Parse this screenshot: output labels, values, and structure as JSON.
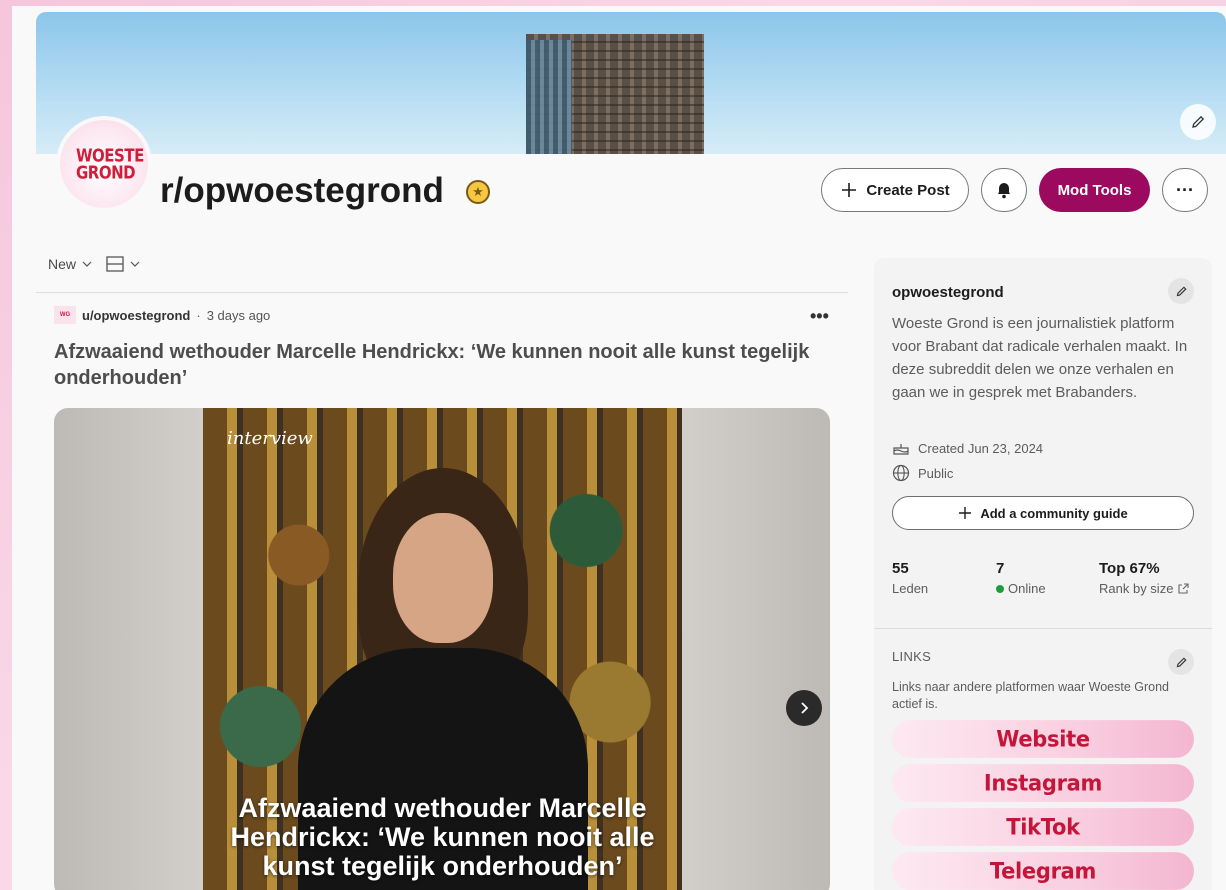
{
  "subreddit": {
    "name": "r/opwoestegrond",
    "logo_text": "WOESTE GROND"
  },
  "header": {
    "create_post_label": "Create Post",
    "mod_tools_label": "Mod Tools",
    "more_label": "···"
  },
  "feed": {
    "sort_label": "New"
  },
  "post": {
    "author": "u/opwoestegrond",
    "separator": "·",
    "time": "3 days ago",
    "title": "Afzwaaiend wethouder Marcelle Hendrickx: ‘We kunnen nooit alle kunst tegelijk onderhouden’",
    "more_label": "•••",
    "media_tag": "interview",
    "media_caption": "Afzwaaiend wethouder Marcelle Hendrickx: ‘We kunnen nooit alle kunst tegelijk onderhouden’"
  },
  "sidebar": {
    "name": "opwoestegrond",
    "description": "Woeste Grond is een journalistiek platform voor Brabant dat radicale verhalen maakt. In deze subreddit delen we onze verhalen en gaan we in gesprek met Brabanders.",
    "created": "Created Jun 23, 2024",
    "visibility": "Public",
    "guide_button": "Add a community guide",
    "stats": [
      {
        "value": "55",
        "label": "Leden"
      },
      {
        "value": "7",
        "label": "Online"
      },
      {
        "value": "Top 67%",
        "label": "Rank by size"
      }
    ],
    "links_heading": "LINKS",
    "links_description": "Links naar andere platformen waar Woeste Grond actief is.",
    "links": [
      "Website",
      "Instagram",
      "TikTok",
      "Telegram"
    ],
    "online_color": "#1e9d3c"
  },
  "colors": {
    "accent": "#9b0a5e",
    "brand_red": "#d01e3a"
  }
}
